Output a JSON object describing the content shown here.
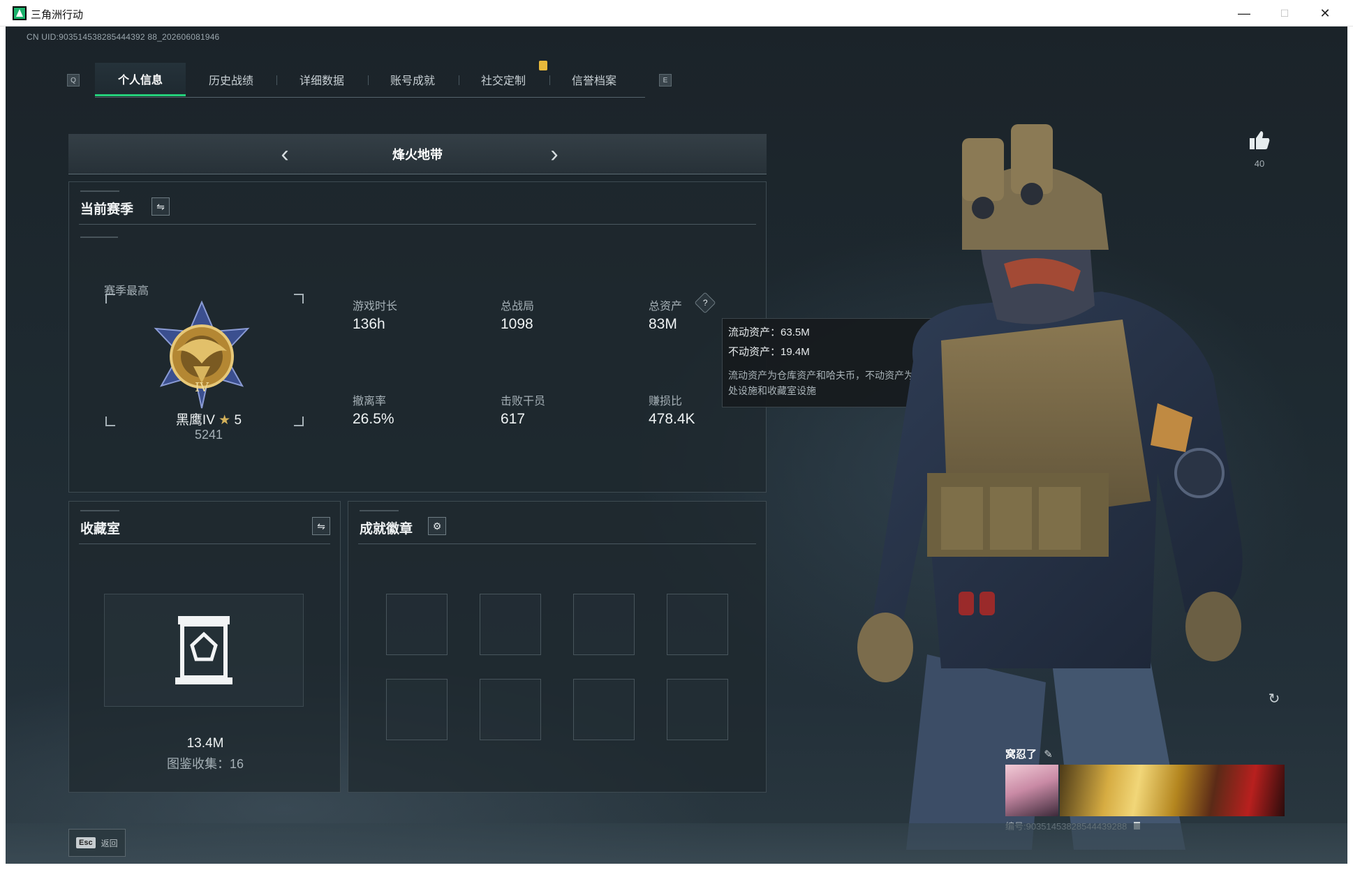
{
  "window": {
    "title": "三角洲行动",
    "minimize": "—",
    "maximize": "☐",
    "close": "✕"
  },
  "uid_line": "CN UID:903514538285444392 88_202606081946",
  "tabs": [
    {
      "label": "个人信息",
      "active": true
    },
    {
      "label": "历史战绩"
    },
    {
      "label": "详细数据"
    },
    {
      "label": "账号成就"
    },
    {
      "label": "社交定制"
    },
    {
      "label": "信誉档案"
    }
  ],
  "tab_keys": {
    "left": "Q",
    "right": "E"
  },
  "mode": {
    "title": "烽火地带",
    "prev": "‹",
    "next": "›"
  },
  "season": {
    "title": "当前赛季",
    "best_label": "赛季最高",
    "rank_name": "黑鹰IV",
    "rank_stars": "5",
    "rank_score": "5241",
    "stats": [
      {
        "label": "游戏时长",
        "value": "136h"
      },
      {
        "label": "总战局",
        "value": "1098"
      },
      {
        "label": "总资产",
        "value": "83M"
      },
      {
        "label": "撤离率",
        "value": "26.5%"
      },
      {
        "label": "击败干员",
        "value": "617"
      },
      {
        "label": "赚损比",
        "value": "478.4K"
      }
    ]
  },
  "tooltip": {
    "liquid": "流动资产：63.5M",
    "fixed": "不动资产：19.4M",
    "desc": "流动资产为仓库资产和哈夫币，不动资产为特勤处设施和收藏室设施"
  },
  "collection": {
    "title": "收藏室",
    "value": "13.4M",
    "count_label": "图鉴收集：16"
  },
  "badges": {
    "title": "成就徽章",
    "slots": 8
  },
  "like": {
    "count": "40"
  },
  "card": {
    "name": "窝忍了",
    "id": "编号:90351453828544439288"
  },
  "back": {
    "key": "Esc",
    "label": "返回"
  },
  "colors": {
    "accent": "#25d07b",
    "badge": "#e8b93b",
    "tooltip_bg": "#161b1e"
  }
}
